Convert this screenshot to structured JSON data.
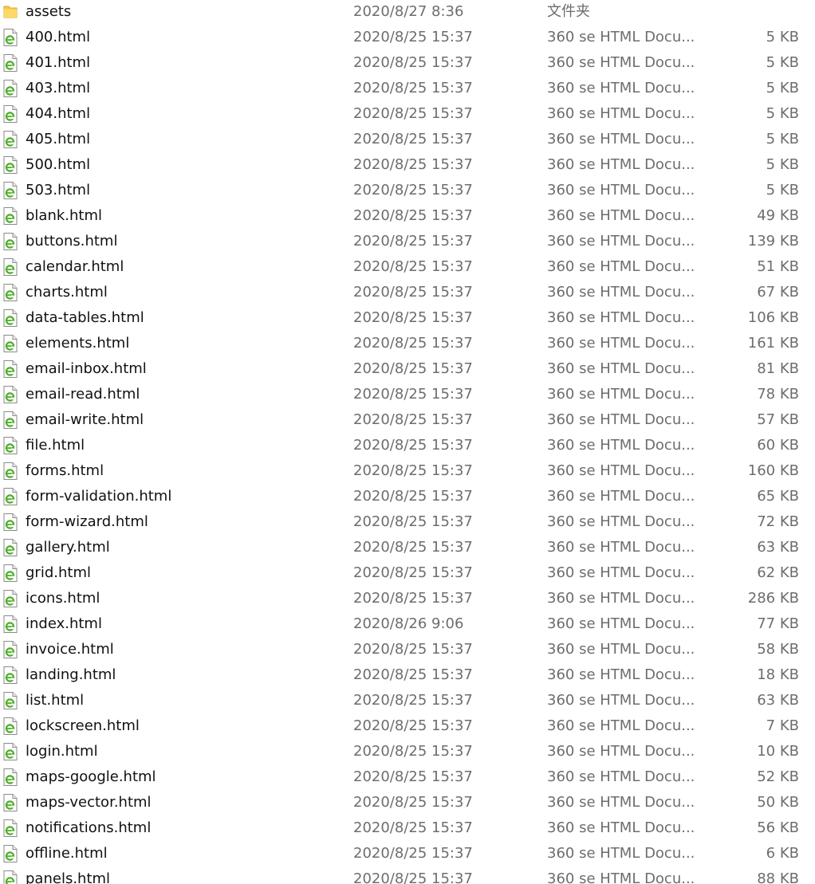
{
  "icons": {
    "folder": "folder-icon",
    "html": "html-file-icon"
  },
  "colors": {
    "folder": "#f5c84c",
    "html_accent": "#4caf26"
  },
  "files": [
    {
      "name": "assets",
      "date": "2020/8/27 8:36",
      "type": "文件夹",
      "size": "",
      "icon": "folder-icon"
    },
    {
      "name": "400.html",
      "date": "2020/8/25 15:37",
      "type": "360 se HTML Docu...",
      "size": "5 KB",
      "icon": "html-file-icon"
    },
    {
      "name": "401.html",
      "date": "2020/8/25 15:37",
      "type": "360 se HTML Docu...",
      "size": "5 KB",
      "icon": "html-file-icon"
    },
    {
      "name": "403.html",
      "date": "2020/8/25 15:37",
      "type": "360 se HTML Docu...",
      "size": "5 KB",
      "icon": "html-file-icon"
    },
    {
      "name": "404.html",
      "date": "2020/8/25 15:37",
      "type": "360 se HTML Docu...",
      "size": "5 KB",
      "icon": "html-file-icon"
    },
    {
      "name": "405.html",
      "date": "2020/8/25 15:37",
      "type": "360 se HTML Docu...",
      "size": "5 KB",
      "icon": "html-file-icon"
    },
    {
      "name": "500.html",
      "date": "2020/8/25 15:37",
      "type": "360 se HTML Docu...",
      "size": "5 KB",
      "icon": "html-file-icon"
    },
    {
      "name": "503.html",
      "date": "2020/8/25 15:37",
      "type": "360 se HTML Docu...",
      "size": "5 KB",
      "icon": "html-file-icon"
    },
    {
      "name": "blank.html",
      "date": "2020/8/25 15:37",
      "type": "360 se HTML Docu...",
      "size": "49 KB",
      "icon": "html-file-icon"
    },
    {
      "name": "buttons.html",
      "date": "2020/8/25 15:37",
      "type": "360 se HTML Docu...",
      "size": "139 KB",
      "icon": "html-file-icon"
    },
    {
      "name": "calendar.html",
      "date": "2020/8/25 15:37",
      "type": "360 se HTML Docu...",
      "size": "51 KB",
      "icon": "html-file-icon"
    },
    {
      "name": "charts.html",
      "date": "2020/8/25 15:37",
      "type": "360 se HTML Docu...",
      "size": "67 KB",
      "icon": "html-file-icon"
    },
    {
      "name": "data-tables.html",
      "date": "2020/8/25 15:37",
      "type": "360 se HTML Docu...",
      "size": "106 KB",
      "icon": "html-file-icon"
    },
    {
      "name": "elements.html",
      "date": "2020/8/25 15:37",
      "type": "360 se HTML Docu...",
      "size": "161 KB",
      "icon": "html-file-icon"
    },
    {
      "name": "email-inbox.html",
      "date": "2020/8/25 15:37",
      "type": "360 se HTML Docu...",
      "size": "81 KB",
      "icon": "html-file-icon"
    },
    {
      "name": "email-read.html",
      "date": "2020/8/25 15:37",
      "type": "360 se HTML Docu...",
      "size": "78 KB",
      "icon": "html-file-icon"
    },
    {
      "name": "email-write.html",
      "date": "2020/8/25 15:37",
      "type": "360 se HTML Docu...",
      "size": "57 KB",
      "icon": "html-file-icon"
    },
    {
      "name": "file.html",
      "date": "2020/8/25 15:37",
      "type": "360 se HTML Docu...",
      "size": "60 KB",
      "icon": "html-file-icon"
    },
    {
      "name": "forms.html",
      "date": "2020/8/25 15:37",
      "type": "360 se HTML Docu...",
      "size": "160 KB",
      "icon": "html-file-icon"
    },
    {
      "name": "form-validation.html",
      "date": "2020/8/25 15:37",
      "type": "360 se HTML Docu...",
      "size": "65 KB",
      "icon": "html-file-icon"
    },
    {
      "name": "form-wizard.html",
      "date": "2020/8/25 15:37",
      "type": "360 se HTML Docu...",
      "size": "72 KB",
      "icon": "html-file-icon"
    },
    {
      "name": "gallery.html",
      "date": "2020/8/25 15:37",
      "type": "360 se HTML Docu...",
      "size": "63 KB",
      "icon": "html-file-icon"
    },
    {
      "name": "grid.html",
      "date": "2020/8/25 15:37",
      "type": "360 se HTML Docu...",
      "size": "62 KB",
      "icon": "html-file-icon"
    },
    {
      "name": "icons.html",
      "date": "2020/8/25 15:37",
      "type": "360 se HTML Docu...",
      "size": "286 KB",
      "icon": "html-file-icon"
    },
    {
      "name": "index.html",
      "date": "2020/8/26 9:06",
      "type": "360 se HTML Docu...",
      "size": "77 KB",
      "icon": "html-file-icon"
    },
    {
      "name": "invoice.html",
      "date": "2020/8/25 15:37",
      "type": "360 se HTML Docu...",
      "size": "58 KB",
      "icon": "html-file-icon"
    },
    {
      "name": "landing.html",
      "date": "2020/8/25 15:37",
      "type": "360 se HTML Docu...",
      "size": "18 KB",
      "icon": "html-file-icon"
    },
    {
      "name": "list.html",
      "date": "2020/8/25 15:37",
      "type": "360 se HTML Docu...",
      "size": "63 KB",
      "icon": "html-file-icon"
    },
    {
      "name": "lockscreen.html",
      "date": "2020/8/25 15:37",
      "type": "360 se HTML Docu...",
      "size": "7 KB",
      "icon": "html-file-icon"
    },
    {
      "name": "login.html",
      "date": "2020/8/25 15:37",
      "type": "360 se HTML Docu...",
      "size": "10 KB",
      "icon": "html-file-icon"
    },
    {
      "name": "maps-google.html",
      "date": "2020/8/25 15:37",
      "type": "360 se HTML Docu...",
      "size": "52 KB",
      "icon": "html-file-icon"
    },
    {
      "name": "maps-vector.html",
      "date": "2020/8/25 15:37",
      "type": "360 se HTML Docu...",
      "size": "50 KB",
      "icon": "html-file-icon"
    },
    {
      "name": "notifications.html",
      "date": "2020/8/25 15:37",
      "type": "360 se HTML Docu...",
      "size": "56 KB",
      "icon": "html-file-icon"
    },
    {
      "name": "offline.html",
      "date": "2020/8/25 15:37",
      "type": "360 se HTML Docu...",
      "size": "6 KB",
      "icon": "html-file-icon"
    },
    {
      "name": "panels.html",
      "date": "2020/8/25 15:37",
      "type": "360 se HTML Docu...",
      "size": "88 KB",
      "icon": "html-file-icon"
    }
  ]
}
